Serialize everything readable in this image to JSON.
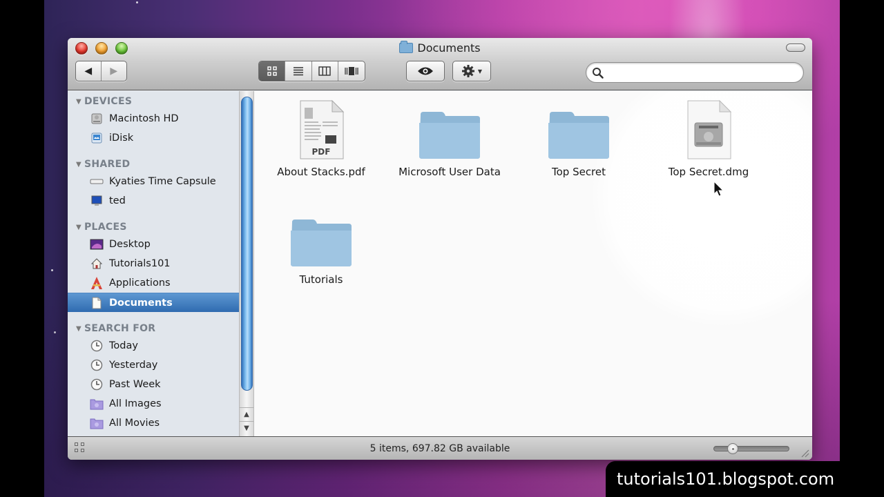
{
  "window": {
    "title": "Documents",
    "title_icon": "folder-icon"
  },
  "toolbar": {
    "back_icon": "◀",
    "forward_icon": "▶",
    "view_modes": [
      {
        "name": "icon-view",
        "glyph": "icon",
        "active": true
      },
      {
        "name": "list-view",
        "glyph": "list",
        "active": false
      },
      {
        "name": "column-view",
        "glyph": "columns",
        "active": false
      },
      {
        "name": "coverflow-view",
        "glyph": "coverflow",
        "active": false
      }
    ],
    "quicklook_icon": "eye-icon",
    "action_icon": "gear-icon",
    "search": {
      "value": "",
      "placeholder": ""
    }
  },
  "sidebar": {
    "sections": [
      {
        "title": "DEVICES",
        "items": [
          {
            "label": "Macintosh HD",
            "icon": "hard-drive-icon"
          },
          {
            "label": "iDisk",
            "icon": "idisk-icon"
          }
        ]
      },
      {
        "title": "SHARED",
        "items": [
          {
            "label": "Kyaties Time Capsule",
            "icon": "time-capsule-icon"
          },
          {
            "label": "ted",
            "icon": "computer-icon"
          }
        ]
      },
      {
        "title": "PLACES",
        "items": [
          {
            "label": "Desktop",
            "icon": "desktop-icon"
          },
          {
            "label": "Tutorials101",
            "icon": "home-icon"
          },
          {
            "label": "Applications",
            "icon": "applications-icon"
          },
          {
            "label": "Documents",
            "icon": "documents-icon",
            "selected": true
          }
        ]
      },
      {
        "title": "SEARCH FOR",
        "items": [
          {
            "label": "Today",
            "icon": "clock-icon"
          },
          {
            "label": "Yesterday",
            "icon": "clock-icon"
          },
          {
            "label": "Past Week",
            "icon": "clock-icon"
          },
          {
            "label": "All Images",
            "icon": "smart-folder-icon"
          },
          {
            "label": "All Movies",
            "icon": "smart-folder-icon"
          }
        ]
      }
    ]
  },
  "files": [
    {
      "name": "About Stacks.pdf",
      "type": "pdf",
      "badge": "PDF"
    },
    {
      "name": "Microsoft User Data",
      "type": "folder"
    },
    {
      "name": "Top Secret",
      "type": "folder"
    },
    {
      "name": "Top Secret.dmg",
      "type": "dmg"
    },
    {
      "name": "Tutorials",
      "type": "folder"
    }
  ],
  "statusbar": {
    "text": "5 items, 697.82 GB available",
    "icon_size_slider": 0.25
  },
  "watermark": "tutorials101.blogspot.com",
  "colors": {
    "selection": "#3a78bf",
    "folder_blue": "#8fbcdc",
    "sidebar_bg": "#e1e6ec"
  }
}
